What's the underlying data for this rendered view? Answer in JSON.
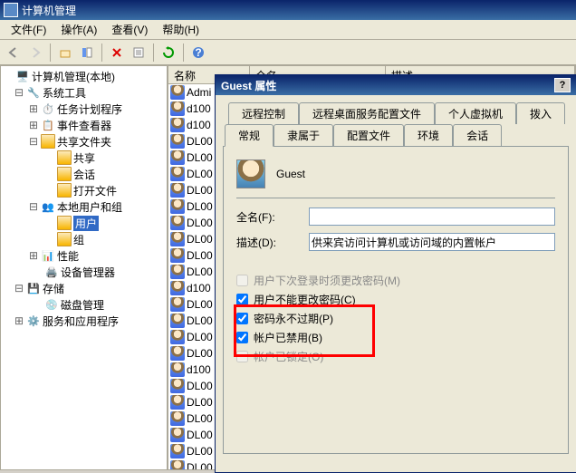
{
  "window": {
    "title": "计算机管理"
  },
  "menu": {
    "file": "文件(F)",
    "action": "操作(A)",
    "view": "查看(V)",
    "help": "帮助(H)"
  },
  "tree": {
    "root": "计算机管理(本地)",
    "system_tools": "系统工具",
    "task_scheduler": "任务计划程序",
    "event_viewer": "事件查看器",
    "shared_folders": "共享文件夹",
    "shares": "共享",
    "sessions": "会话",
    "open_files": "打开文件",
    "local_users_groups": "本地用户和组",
    "users": "用户",
    "groups": "组",
    "performance": "性能",
    "device_manager": "设备管理器",
    "storage": "存储",
    "disk_management": "磁盘管理",
    "services_apps": "服务和应用程序"
  },
  "list": {
    "col_name": "名称",
    "col_fullname": "全名",
    "col_desc": "描述",
    "rows": [
      {
        "name": "Admi"
      },
      {
        "name": "d100"
      },
      {
        "name": "d100"
      },
      {
        "name": "DL00"
      },
      {
        "name": "DL00"
      },
      {
        "name": "DL00"
      },
      {
        "name": "DL00"
      },
      {
        "name": "DL00"
      },
      {
        "name": "DL00"
      },
      {
        "name": "DL00"
      },
      {
        "name": "DL00"
      },
      {
        "name": "DL00"
      },
      {
        "name": "d100"
      },
      {
        "name": "DL00"
      },
      {
        "name": "DL00"
      },
      {
        "name": "DL00"
      },
      {
        "name": "DL00"
      },
      {
        "name": "d100"
      },
      {
        "name": "DL00"
      },
      {
        "name": "DL00"
      },
      {
        "name": "DL00"
      },
      {
        "name": "DL00"
      },
      {
        "name": "DL00"
      },
      {
        "name": "DL00"
      }
    ]
  },
  "dialog": {
    "title": "Guest 属性",
    "tabs_row1": {
      "remote_control": "远程控制",
      "rds_profile": "远程桌面服务配置文件",
      "personal_vm": "个人虚拟机",
      "dialin": "拨入"
    },
    "tabs_row2": {
      "general": "常规",
      "member_of": "隶属于",
      "profile": "配置文件",
      "environment": "环境",
      "sessions": "会话"
    },
    "username": "Guest",
    "fullname_label": "全名(F):",
    "fullname_value": "",
    "desc_label": "描述(D):",
    "desc_value": "供来宾访问计算机或访问域的内置帐户",
    "chk_must_change": "用户下次登录时须更改密码(M)",
    "chk_cannot_change": "用户不能更改密码(C)",
    "chk_never_expire": "密码永不过期(P)",
    "chk_disabled": "帐户已禁用(B)",
    "chk_locked": "帐户已锁定(O)"
  }
}
